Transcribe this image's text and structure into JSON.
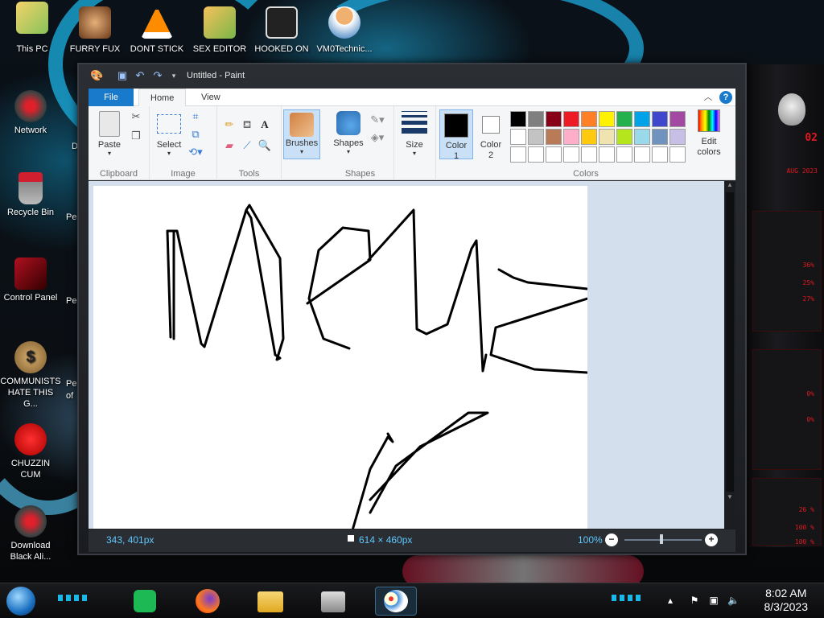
{
  "desktop": {
    "icons": [
      {
        "label": "This PC"
      },
      {
        "label": "FURRY FUX"
      },
      {
        "label": "DONT STICK"
      },
      {
        "label": "SEX EDITOR"
      },
      {
        "label": "HOOKED ON"
      },
      {
        "label": "VM0Technic..."
      },
      {
        "label": "Network"
      },
      {
        "label": "Recycle Bin"
      },
      {
        "label": "Control Panel"
      },
      {
        "label": "COMMUNISTS HATE THIS G..."
      },
      {
        "label": "CHUZZIN CUM"
      },
      {
        "label": "Download Black Ali..."
      }
    ],
    "partial_labels": [
      "Pe",
      "Pe",
      "Pe",
      "of",
      "D"
    ]
  },
  "gadget": {
    "header": "02",
    "date": "AUG 2023",
    "panel1": [
      "36%",
      "25%",
      "27%"
    ],
    "panel2": [
      "0%",
      "0%"
    ],
    "panel3": [
      "26 %",
      "100 %",
      "100 %"
    ]
  },
  "paint": {
    "title": "Untitled - Paint",
    "tabs": {
      "file": "File",
      "home": "Home",
      "view": "View"
    },
    "ribbon": {
      "clipboard": {
        "paste": "Paste",
        "label": "Clipboard"
      },
      "image": {
        "select": "Select",
        "label": "Image"
      },
      "tools": {
        "label": "Tools"
      },
      "brushes": {
        "label": "Brushes"
      },
      "shapes": {
        "shapes": "Shapes",
        "label": "Shapes"
      },
      "size": {
        "label": "Size"
      },
      "colors": {
        "color1": "Color 1",
        "color2": "Color 2",
        "edit": "Edit colors",
        "label": "Colors",
        "palette_row1": [
          "#000000",
          "#7f7f7f",
          "#880015",
          "#ed1c24",
          "#ff7f27",
          "#fff200",
          "#22b14c",
          "#00a2e8",
          "#3f48cc",
          "#a349a4"
        ],
        "palette_row2": [
          "#ffffff",
          "#c3c3c3",
          "#b97a57",
          "#ffaec9",
          "#ffc90e",
          "#efe4b0",
          "#b5e61d",
          "#99d9ea",
          "#7092be",
          "#c8bfe7"
        ],
        "palette_row3": [
          "#ffffff",
          "#ffffff",
          "#ffffff",
          "#ffffff",
          "#ffffff",
          "#ffffff",
          "#ffffff",
          "#ffffff",
          "#ffffff",
          "#ffffff"
        ],
        "color1_value": "#000000",
        "color2_value": "#ffffff"
      }
    },
    "status": {
      "cursor": "343, 401px",
      "canvas_size": "614 × 460px",
      "zoom": "100%"
    }
  },
  "taskbar": {
    "time": "8:02 AM",
    "date": "8/3/2023"
  }
}
